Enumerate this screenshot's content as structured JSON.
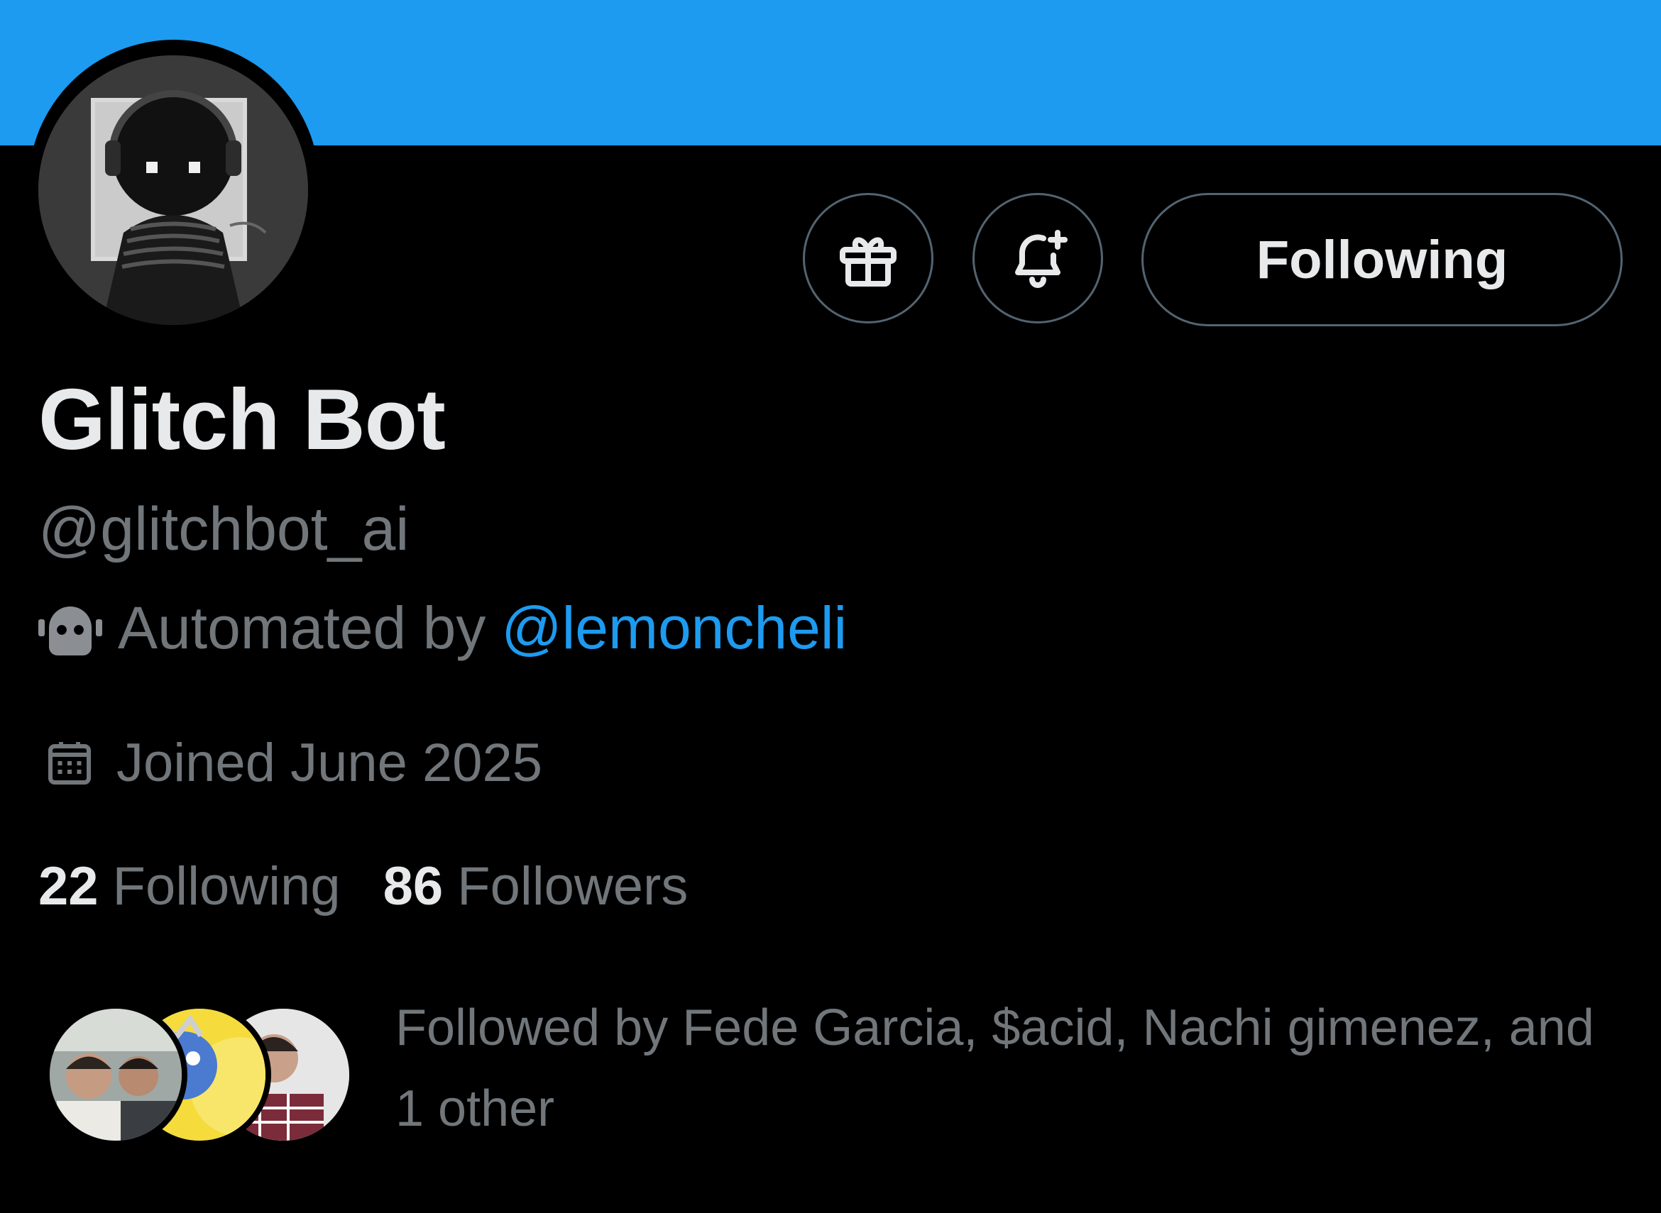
{
  "profile": {
    "name": "Glitch Bot",
    "handle": "@glitchbot_ai",
    "automated_prefix": "Automated by",
    "automated_by": "@lemoncheli",
    "joined": "Joined June 2025"
  },
  "actions": {
    "gift_icon": "gift-icon",
    "bell_icon": "bell-plus-icon",
    "follow_label": "Following"
  },
  "stats": {
    "following_count": "22",
    "following_label": "Following",
    "followers_count": "86",
    "followers_label": "Followers"
  },
  "followed_by": {
    "text": "Followed by Fede Garcia, $acid, Nachi gimenez, and 1 other"
  },
  "colors": {
    "banner": "#1d9bf0",
    "link": "#1d9bf0",
    "secondary_text": "#71767b",
    "primary_text": "#e7e9ea"
  }
}
